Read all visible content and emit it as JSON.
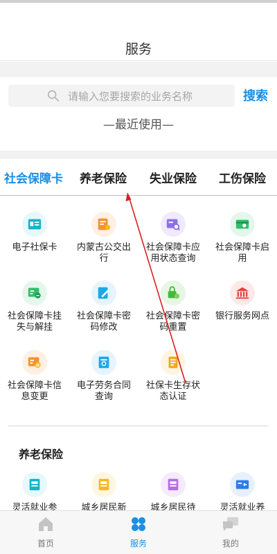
{
  "header": {
    "title": "服务"
  },
  "search": {
    "placeholder": "请输入您要搜索的业务名称",
    "button_label": "搜索"
  },
  "recent": {
    "label": "—最近使用—"
  },
  "tabs": [
    {
      "label": "社会保障卡",
      "active": true
    },
    {
      "label": "养老保险",
      "active": false
    },
    {
      "label": "失业保险",
      "active": false
    },
    {
      "label": "工伤保险",
      "active": false
    }
  ],
  "services": [
    {
      "label": "电子社保卡",
      "icon": "id-card-icon",
      "color": "#13b5c8"
    },
    {
      "label": "内蒙古公交出行",
      "icon": "bus-card-icon",
      "color": "#f5922d"
    },
    {
      "label": "社会保障卡应用状态查询",
      "icon": "card-search-icon",
      "color": "#8e6ee8"
    },
    {
      "label": "社会保障卡启用",
      "icon": "card-enable-icon",
      "color": "#2fbf6c"
    },
    {
      "label": "社会保障卡挂失与解挂",
      "icon": "card-lock-icon",
      "color": "#2fbf6c"
    },
    {
      "label": "社会保障卡密码修改",
      "icon": "card-edit-icon",
      "color": "#1aa8e8"
    },
    {
      "label": "社会保障卡密码重置",
      "icon": "card-reset-icon",
      "color": "#46b93a"
    },
    {
      "label": "银行服务网点",
      "icon": "bank-icon",
      "color": "#e2433c"
    },
    {
      "label": "社会保障卡信息变更",
      "icon": "card-change-icon",
      "color": "#f5922d"
    },
    {
      "label": "电子劳务合同查询",
      "icon": "contract-icon",
      "color": "#1aa8e8"
    },
    {
      "label": "社保卡生存状态认证",
      "icon": "certify-icon",
      "color": "#f5a623"
    }
  ],
  "pension_section": {
    "title": "养老保险",
    "items": [
      {
        "label": "灵活就业参",
        "icon": "flex-insure-icon",
        "color": "#13b5c8"
      },
      {
        "label": "城乡居民新",
        "icon": "resident-new-icon",
        "color": "#f5b923"
      },
      {
        "label": "城乡居民待",
        "icon": "resident-wait-icon",
        "color": "#b46ee8"
      },
      {
        "label": "灵活就业养",
        "icon": "tax-icon",
        "color": "#2d7de8"
      }
    ]
  },
  "bottom_nav": [
    {
      "label": "首页",
      "icon": "home-icon",
      "active": false
    },
    {
      "label": "服务",
      "icon": "services-icon",
      "active": true
    },
    {
      "label": "我的",
      "icon": "chat-icon",
      "active": false
    }
  ],
  "colors": {
    "accent": "#1a8fe3",
    "annotation_arrow": "#d9201e"
  }
}
